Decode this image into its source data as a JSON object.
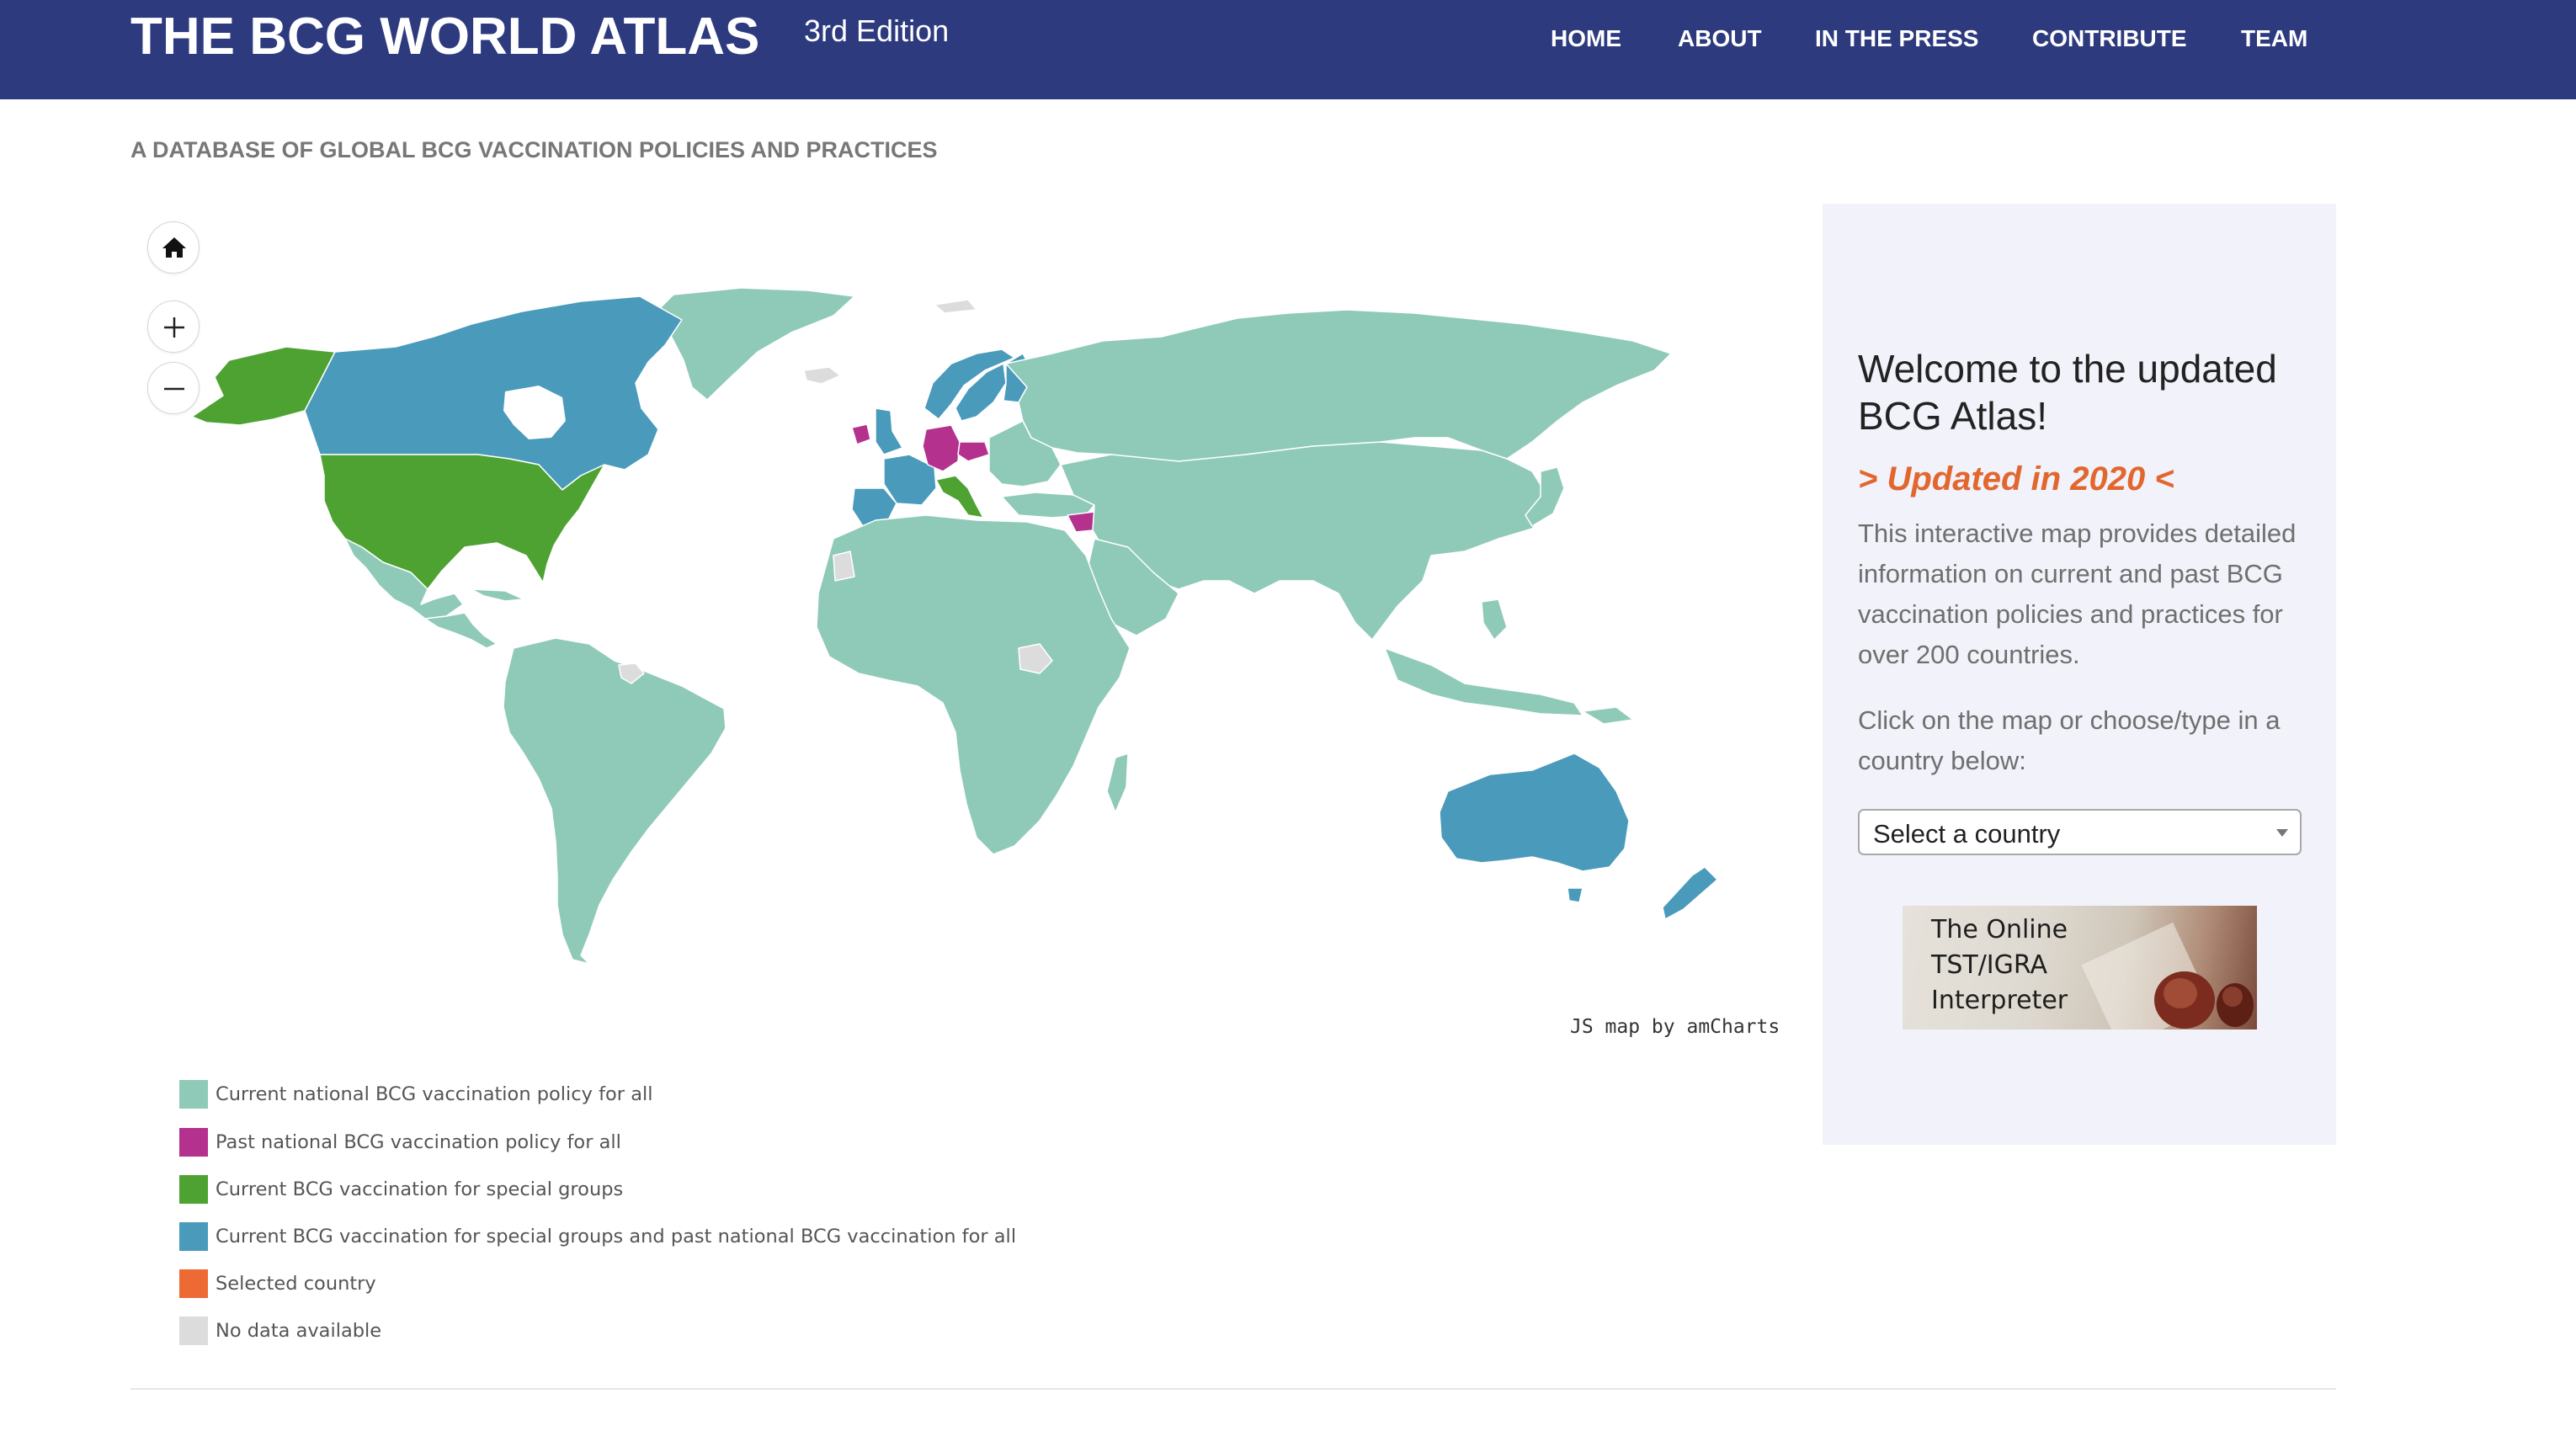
{
  "header": {
    "title": "THE BCG WORLD ATLAS",
    "edition": "3rd Edition",
    "nav": [
      "HOME",
      "ABOUT",
      "IN THE PRESS",
      "CONTRIBUTE",
      "TEAM"
    ],
    "background_color": "#2d3a7e"
  },
  "subtitle": "A DATABASE OF GLOBAL BCG VACCINATION POLICIES AND PRACTICES",
  "map": {
    "controls": [
      "home-icon",
      "zoom-in-icon",
      "zoom-out-icon"
    ],
    "credit": "JS map by amCharts"
  },
  "legend": [
    {
      "label": "Current national BCG vaccination policy for all",
      "color": "#8fcab9"
    },
    {
      "label": "Past national BCG vaccination policy for all",
      "color": "#b5318e"
    },
    {
      "label": "Current BCG vaccination for special groups",
      "color": "#4ea232"
    },
    {
      "label": "Current BCG vaccination for special groups and past national BCG vaccination for all",
      "color": "#4a9abb"
    },
    {
      "label": "Selected country",
      "color": "#ed6a34"
    },
    {
      "label": "No data available",
      "color": "#dcdcdc"
    }
  ],
  "panel": {
    "welcome": "Welcome to the updated BCG Atlas!",
    "updated": "> Updated in 2020 <",
    "description": "This interactive map provides detailed information on current and past BCG vaccination policies and practices for over 200 countries.",
    "instruction": "Click on the map or choose/type in a country below:",
    "select_placeholder": "Select a country",
    "promo_lines": [
      "The Online",
      "TST/IGRA",
      "Interpreter"
    ]
  }
}
